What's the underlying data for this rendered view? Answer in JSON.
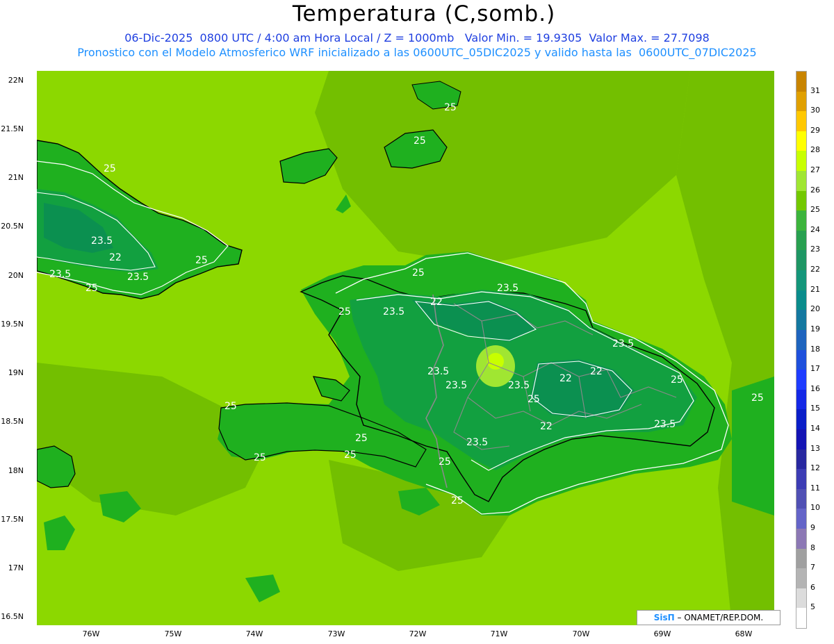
{
  "header": {
    "title": "Temperatura (C,somb.)",
    "line1": "06-Dic-2025  0800 UTC / 4:00 am Hora Local / Z = 1000mb   Valor Min. = 19.9305  Valor Max. = 27.7098",
    "line2": "Pronostico con el Modelo Atmosferico WRF inicializado a las 0600UTC_05DIC2025 y valido hasta las  0600UTC_07DIC2025"
  },
  "map": {
    "lat_labels": [
      "22N",
      "21.5N",
      "21N",
      "20.5N",
      "20N",
      "19.5N",
      "19N",
      "18.5N",
      "18N",
      "17.5N",
      "17N",
      "16.5N"
    ],
    "lon_labels": [
      "76W",
      "75W",
      "74W",
      "73W",
      "72W",
      "71W",
      "70W",
      "69W",
      "68W"
    ],
    "contour_labels": [
      "25",
      "25",
      "25",
      "25",
      "25",
      "25",
      "25",
      "25",
      "25",
      "25",
      "25",
      "25",
      "25",
      "25",
      "25",
      "25",
      "23.5",
      "23.5",
      "23.5",
      "23.5",
      "23.5",
      "23.5",
      "23.5",
      "23.5",
      "23.5",
      "23.5",
      "23.5",
      "22",
      "22",
      "22",
      "22",
      "22"
    ],
    "colors": {
      "sea_light": "#8cd800",
      "sea_mid": "#73bf00",
      "land_24": "#1fb01f",
      "land_23": "#12a040",
      "land_22": "#0b9050",
      "coast": "#000000",
      "contour": "#ffffff",
      "borders": "#8a8a8a"
    }
  },
  "credit": {
    "brand": "SisΠ",
    "text": " – ONAMET/REP.DOM."
  },
  "legend": {
    "labels": [
      "31",
      "30",
      "29",
      "28",
      "27",
      "26",
      "25",
      "24",
      "23",
      "22",
      "21",
      "20",
      "19",
      "18",
      "17",
      "16",
      "15",
      "14",
      "13",
      "12",
      "11",
      "10",
      "9",
      "8",
      "7",
      "6",
      "5"
    ],
    "colors": [
      "#c88400",
      "#e0a000",
      "#ffc800",
      "#ffff00",
      "#c8ff00",
      "#a0e632",
      "#73c800",
      "#3cb43c",
      "#28a050",
      "#1e9664",
      "#14967a",
      "#0a8c8c",
      "#1478a0",
      "#1e64be",
      "#1e50dc",
      "#1e3cff",
      "#1428e6",
      "#0a1ec8",
      "#1414b4",
      "#2828a0",
      "#3c3cb4",
      "#5050b4",
      "#6464c8",
      "#8c78b4",
      "#a0a0a0",
      "#b4b4b4",
      "#dcdcdc",
      "#ffffff"
    ]
  }
}
